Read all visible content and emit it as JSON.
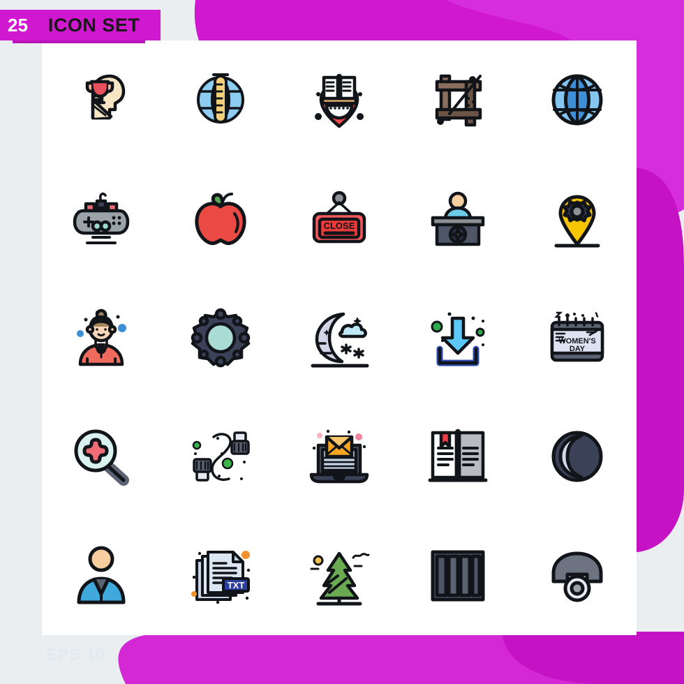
{
  "header": {
    "count_badge": "25",
    "title": "ICON SET",
    "badge_color": "#cf18cf",
    "title_color": "#181818"
  },
  "footer": {
    "format_label": "EPS 10",
    "color": "#e3e9ec"
  },
  "theme": {
    "page_background": "#eaeef0",
    "card_background": "#ffffff",
    "accent_magenta": "#cf18cf",
    "accent_magenta_light": "#d62ddd",
    "accent_magenta_dark": "#b713b7",
    "outline": "#111418"
  },
  "grid": {
    "columns": 5,
    "rows": 5,
    "total_icons": 25
  },
  "icons": [
    {
      "index": 1,
      "row": 1,
      "col": 1,
      "name": "head-trophy-icon",
      "label": "Mind Achievement",
      "colors": [
        "#f5e1bb",
        "#e8505b",
        "#111418"
      ]
    },
    {
      "index": 2,
      "row": 1,
      "col": 2,
      "name": "globe-thermometer-icon",
      "label": "Global Measure",
      "colors": [
        "#4a9fd8",
        "#8ecdf2",
        "#f2c14e"
      ]
    },
    {
      "index": 3,
      "row": 1,
      "col": 3,
      "name": "heart-book-icon",
      "label": "Love Reading",
      "colors": [
        "#ef4a4a",
        "#ffffff",
        "#111418"
      ]
    },
    {
      "index": 4,
      "row": 1,
      "col": 4,
      "name": "crop-tool-icon",
      "label": "Crop",
      "colors": [
        "#8a6f5c",
        "#6d5546",
        "#111418"
      ]
    },
    {
      "index": 5,
      "row": 1,
      "col": 5,
      "name": "globe-world-icon",
      "label": "World",
      "colors": [
        "#3e8fd6",
        "#85c6f0",
        "#111418"
      ]
    },
    {
      "index": 6,
      "row": 2,
      "col": 1,
      "name": "gamepad-icon",
      "label": "Game Controller",
      "colors": [
        "#9aa3a8",
        "#ef6b76",
        "#9ddbc8"
      ]
    },
    {
      "index": 7,
      "row": 2,
      "col": 2,
      "name": "apple-icon",
      "label": "Apple",
      "colors": [
        "#ea4a43",
        "#5aa75a",
        "#111418"
      ]
    },
    {
      "index": 8,
      "row": 2,
      "col": 3,
      "name": "close-sign-icon",
      "label": "Close Sign",
      "sign_text": "CLOSE",
      "colors": [
        "#f4595c",
        "#ef3a3a",
        "#8d9196"
      ]
    },
    {
      "index": 9,
      "row": 2,
      "col": 4,
      "name": "reception-desk-icon",
      "label": "Reception Desk",
      "colors": [
        "#4e5668",
        "#6bcbe8",
        "#f7ceA0"
      ]
    },
    {
      "index": 10,
      "row": 2,
      "col": 5,
      "name": "location-settings-icon",
      "label": "Location Settings",
      "colors": [
        "#f6c400",
        "#8d9196",
        "#111418"
      ]
    },
    {
      "index": 11,
      "row": 3,
      "col": 1,
      "name": "woman-avatar-icon",
      "label": "Woman",
      "colors": [
        "#f06a5e",
        "#f7d7b8",
        "#a9855f"
      ]
    },
    {
      "index": 12,
      "row": 3,
      "col": 2,
      "name": "settings-gear-icon",
      "label": "Settings",
      "colors": [
        "#3b4257",
        "#a8dcd4",
        "#111418"
      ]
    },
    {
      "index": 13,
      "row": 3,
      "col": 3,
      "name": "night-snow-icon",
      "label": "Snowy Night",
      "colors": [
        "#d2d4e8",
        "#bfe9f7",
        "#111418"
      ]
    },
    {
      "index": 14,
      "row": 3,
      "col": 4,
      "name": "download-icon",
      "label": "Download",
      "colors": [
        "#2b4bb0",
        "#5bc8f5",
        "#2bab4e"
      ]
    },
    {
      "index": 15,
      "row": 3,
      "col": 5,
      "name": "womens-day-calendar-icon",
      "label": "Women's Day",
      "calendar_text": [
        "WOMEN'S",
        "DAY"
      ],
      "colors": [
        "#dfe2f2",
        "#5b6272",
        "#111418"
      ]
    },
    {
      "index": 16,
      "row": 4,
      "col": 1,
      "name": "search-plus-icon",
      "label": "Medical Search",
      "colors": [
        "#d9f2ee",
        "#ef6b76",
        "#5b6272"
      ]
    },
    {
      "index": 17,
      "row": 4,
      "col": 2,
      "name": "usb-cable-icon",
      "label": "USB Cable",
      "colors": [
        "#5b6272",
        "#3cb44a",
        "#ffffff"
      ]
    },
    {
      "index": 18,
      "row": 4,
      "col": 3,
      "name": "laptop-email-icon",
      "label": "Email on Laptop",
      "colors": [
        "#4e5668",
        "#f5a623",
        "#c6d4e8"
      ]
    },
    {
      "index": 19,
      "row": 4,
      "col": 4,
      "name": "open-book-icon",
      "label": "Open Book",
      "colors": [
        "#ffffff",
        "#b8bcc2",
        "#ef3a4a"
      ]
    },
    {
      "index": 20,
      "row": 4,
      "col": 5,
      "name": "moon-phase-icon",
      "label": "Night Mode",
      "colors": [
        "#3b4257",
        "#d2d8ec",
        "#111418"
      ]
    },
    {
      "index": 21,
      "row": 5,
      "col": 1,
      "name": "businessman-icon",
      "label": "Businessman",
      "colors": [
        "#3fa9dc",
        "#f7ceA0",
        "#5b6272"
      ]
    },
    {
      "index": 22,
      "row": 5,
      "col": 2,
      "name": "txt-file-icon",
      "label": "TXT File",
      "file_badge": "TXT",
      "colors": [
        "#c6d4e8",
        "#2b3f9e",
        "#f0922b"
      ]
    },
    {
      "index": 23,
      "row": 5,
      "col": 3,
      "name": "pine-tree-icon",
      "label": "Pine Tree",
      "colors": [
        "#6aab52",
        "#f2c14e",
        "#111418"
      ]
    },
    {
      "index": 24,
      "row": 5,
      "col": 4,
      "name": "columns-layout-icon",
      "label": "Columns Layout",
      "colors": [
        "#5b6272",
        "#4e5668",
        "#111418"
      ]
    },
    {
      "index": 25,
      "row": 5,
      "col": 5,
      "name": "telephone-icon",
      "label": "Telephone",
      "colors": [
        "#6d7380",
        "#e8eaf2",
        "#111418"
      ]
    }
  ]
}
